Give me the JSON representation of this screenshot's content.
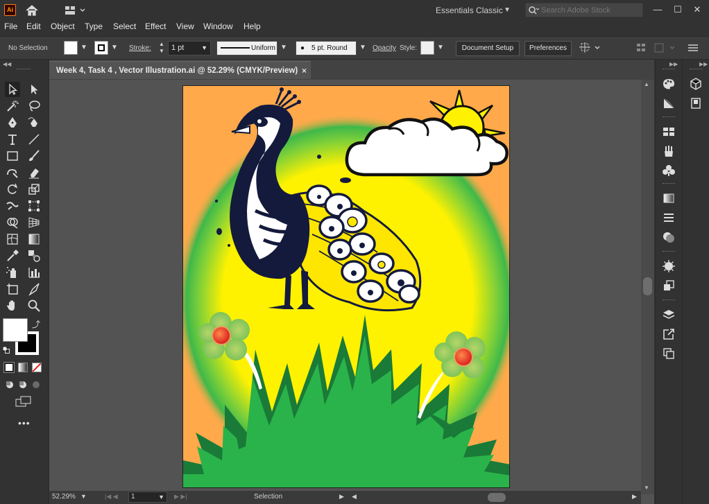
{
  "app": {
    "logo_text": "Ai"
  },
  "titlebar": {
    "workspace": "Essentials Classic",
    "search_placeholder": "Search Adobe Stock",
    "min": "—",
    "max": "☐",
    "close": "✕"
  },
  "menu": [
    "File",
    "Edit",
    "Object",
    "Type",
    "Select",
    "Effect",
    "View",
    "Window",
    "Help"
  ],
  "control": {
    "selection": "No Selection",
    "stroke_label": "Stroke:",
    "stroke_weight": "1 pt",
    "profile": "Uniform",
    "brush": "5 pt. Round",
    "opacity_label": "Opacity",
    "style_label": "Style:",
    "doc_setup": "Document Setup",
    "preferences": "Preferences"
  },
  "document": {
    "tab_title": "Week 4, Task 4 , Vector Illustration.ai @ 52.29% (CMYK/Preview)",
    "close": "×"
  },
  "status": {
    "zoom": "52.29%",
    "page": "1",
    "mode": "Selection"
  },
  "colors": {
    "artboard_bg": "#ffa94a",
    "sun_glow": "#fff200",
    "grass": "#2ab34a",
    "dark_grass": "#1a7a38",
    "peacock_navy": "#141a3c",
    "flower_red": "#e8352a"
  }
}
